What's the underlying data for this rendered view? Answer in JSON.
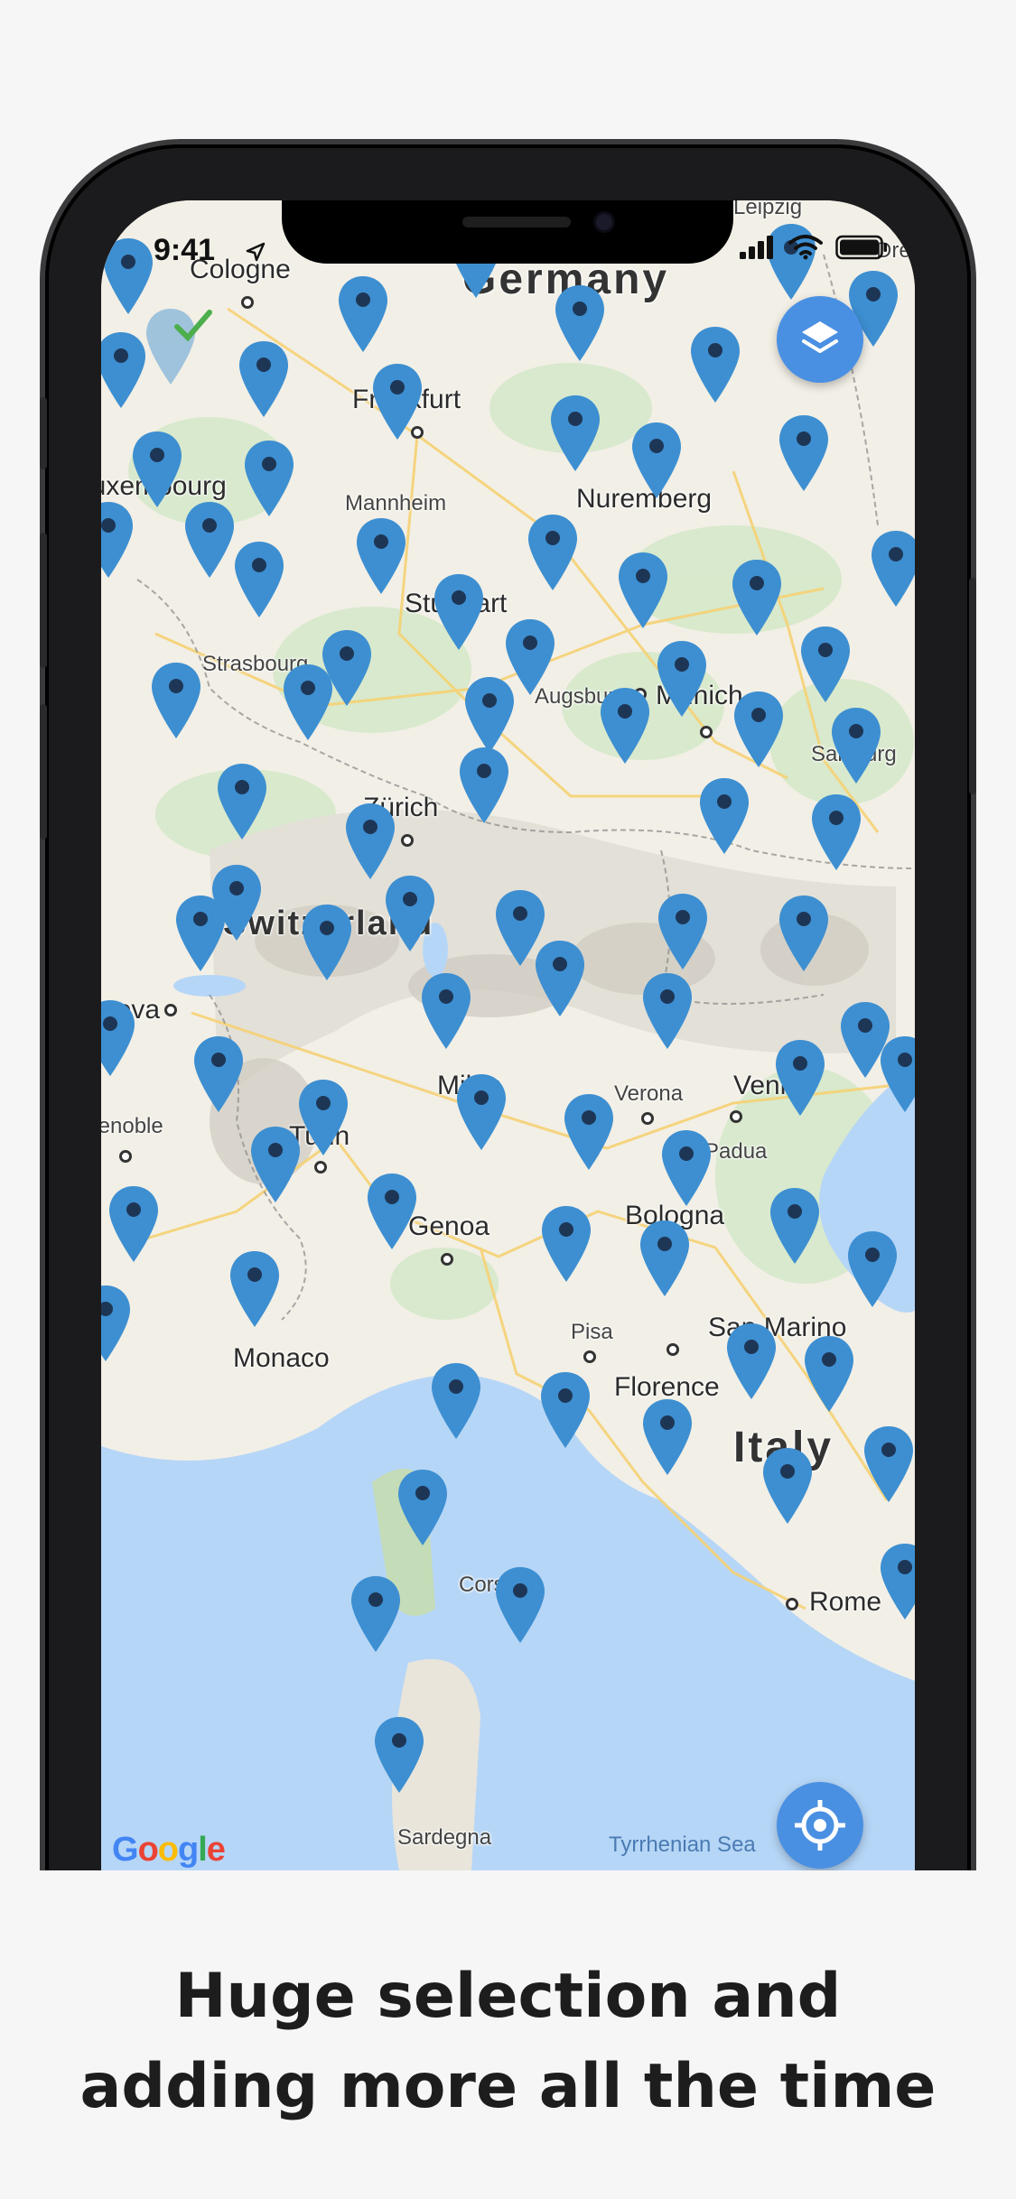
{
  "status_bar": {
    "time": "9:41"
  },
  "map": {
    "labels": {
      "germany": "Germany",
      "cologne": "Cologne",
      "frankfurt": "Frankfurt",
      "luxembourg": "Luxembourg",
      "mannheim": "Mannheim",
      "nuremberg": "Nuremberg",
      "stuttgart": "Stuttgart",
      "strasbourg": "Strasbourg",
      "augsburg": "Augsburg",
      "munich": "Munich",
      "salzburg": "Salzburg",
      "zurich": "Zürich",
      "switzerland": "Switzerland",
      "geneva": "Geneva",
      "grenoble": "Grenoble",
      "turin": "Turin",
      "milan": "Milan",
      "verona": "Verona",
      "venice": "Venice",
      "padua": "Padua",
      "genoa": "Genoa",
      "bologna": "Bologna",
      "monaco": "Monaco",
      "pisa": "Pisa",
      "san_marino": "San Marino",
      "florence": "Florence",
      "italy": "Italy",
      "corse": "Corse",
      "rome": "Rome",
      "sardegna": "Sardegna",
      "tyrrhenian_sea": "Tyrrhenian Sea",
      "leipzig": "Leipzig",
      "dresden": "Dresden"
    },
    "attribution": "Google",
    "pin_color": "#3d8fd1",
    "selected_pin_icon": "checkmark-icon"
  },
  "buttons": {
    "layers_icon": "layers-icon",
    "locate_icon": "crosshair-location-icon"
  },
  "caption": {
    "line1": "Huge selection and",
    "line2": "adding more all the time"
  },
  "colors": {
    "accent": "#4a90e2",
    "water": "#b6d6f7",
    "land": "#f2efe6"
  }
}
